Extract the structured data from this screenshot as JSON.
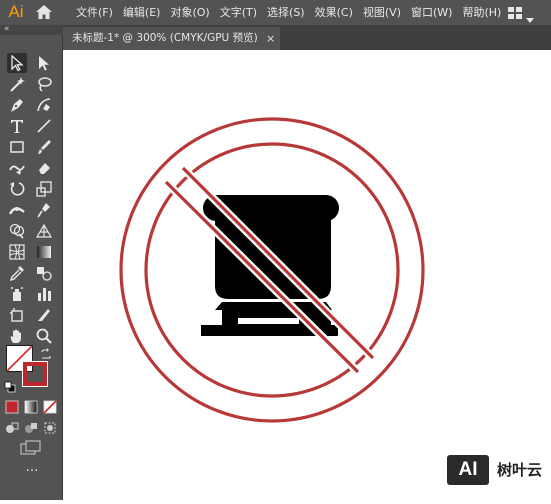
{
  "app": {
    "logo": "Ai",
    "logo_color": "#ff9a00"
  },
  "menubar": {
    "items": [
      "文件(F)",
      "编辑(E)",
      "对象(O)",
      "文字(T)",
      "选择(S)",
      "效果(C)",
      "视图(V)",
      "窗口(W)",
      "帮助(H)"
    ],
    "home_icon": "home-icon",
    "workspace_icon": "workspace-layout-icon"
  },
  "document_tab": {
    "title": "未标题-1* @ 300% (CMYK/GPU 预览)",
    "close": "×"
  },
  "toolbar": {
    "collapse_glyph": "«",
    "tools": [
      "selection-tool",
      "direct-selection-tool",
      "magic-wand-tool",
      "lasso-tool",
      "pen-tool",
      "curvature-tool",
      "type-tool",
      "line-segment-tool",
      "rectangle-tool",
      "paintbrush-tool",
      "shaper-tool",
      "eraser-tool",
      "rotate-tool",
      "scale-tool",
      "width-tool",
      "puppet-warp-tool",
      "shape-builder-tool",
      "perspective-grid-tool",
      "mesh-tool",
      "gradient-tool",
      "eyedropper-tool",
      "blend-tool",
      "symbol-sprayer-tool",
      "column-graph-tool",
      "artboard-tool",
      "slice-tool",
      "hand-tool",
      "zoom-tool"
    ],
    "fill_color": "#ffffff",
    "stroke_color": "#c0262c",
    "more_glyph": "…"
  },
  "artwork": {
    "description_icon": "no-rice-cooker-sign",
    "ring_color": "#b83838",
    "icon_color": "#000000"
  },
  "watermark": {
    "logo": "AI",
    "text": "树叶云"
  }
}
